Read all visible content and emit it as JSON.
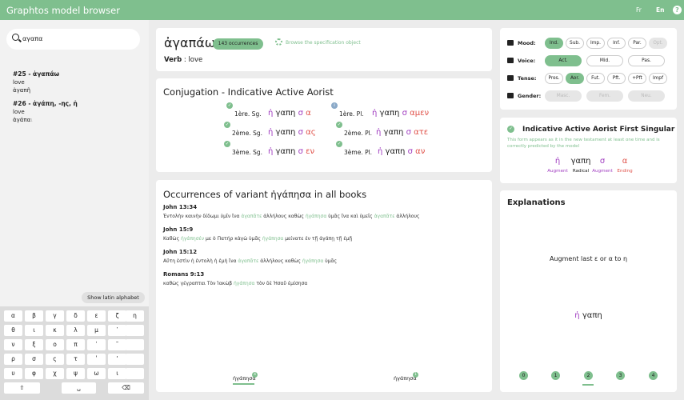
{
  "header": {
    "title": "Graphtos model browser",
    "lang_fr": "Fr",
    "lang_en": "En",
    "help": "?"
  },
  "search": {
    "value": "αγαπα"
  },
  "results": [
    {
      "title": "#25 - ἀγαπάω",
      "gloss": "love",
      "form": "ἀγαπῆ"
    },
    {
      "title": "#26 - ἀγάπη, -ης, ἡ",
      "gloss": "love",
      "form": "ἀγάπα",
      "form_trailing": "ι"
    }
  ],
  "keyboard": {
    "toggle_label": "Show latin alphabet",
    "rows": [
      [
        "α",
        "β",
        "γ",
        "δ",
        "ε",
        "ζ",
        "η"
      ],
      [
        "θ",
        "ι",
        "κ",
        "λ",
        "μ",
        "῾",
        ""
      ],
      [
        "ν",
        "ξ",
        "ο",
        "π",
        "᾿",
        "῀",
        ""
      ],
      [
        "ρ",
        "σ",
        "ς",
        "τ",
        "ʹ",
        "ʼ",
        ""
      ],
      [
        "υ",
        "φ",
        "χ",
        "ψ",
        "ω",
        "ι",
        ""
      ]
    ],
    "shift": "⇧",
    "space": "␣",
    "backspace": "⌫"
  },
  "lemma": {
    "word": "ἀγαπάω",
    "occurrences": "143 occurrences",
    "spec_link": "Browse the specification object",
    "pos": "Verb",
    "gloss": "love"
  },
  "conjugation": {
    "title": "Conjugation - Indicative Active Aorist",
    "items": [
      {
        "label": "1ère. Sg.",
        "aug": "ἠ",
        "rad": "γαπη",
        "ind": "σ",
        "end": "α",
        "status": "check"
      },
      {
        "label": "2ème. Sg.",
        "aug": "ἠ",
        "rad": "γαπη",
        "ind": "σ",
        "end": "ας",
        "status": "check"
      },
      {
        "label": "3ème. Sg.",
        "aug": "ἠ",
        "rad": "γαπη",
        "ind": "σ",
        "end": "εν",
        "status": "check"
      },
      {
        "label": "1ère. Pl.",
        "aug": "ἠ",
        "rad": "γαπη",
        "ind": "σ",
        "end": "αμεν",
        "status": "info"
      },
      {
        "label": "2ème. Pl.",
        "aug": "ἠ",
        "rad": "γαπη",
        "ind": "σ",
        "end": "ατε",
        "status": "check"
      },
      {
        "label": "3ème. Pl.",
        "aug": "ἠ",
        "rad": "γαπη",
        "ind": "σ",
        "end": "αν",
        "status": "check"
      }
    ]
  },
  "occurrences": {
    "title": "Occurrences of variant ἠγάπησα in all books",
    "verses": [
      {
        "ref": "John 13:34",
        "parts": [
          "Ἐντολὴν καινὴν δίδωμι ὑμῖν ἵνα ",
          {
            "hl": "ἀγαπᾶτε"
          },
          " ἀλλήλους καθὼς ",
          {
            "hl": "ἠγάπησα"
          },
          " ὑμᾶς ἵνα καὶ ὑμεῖς ",
          {
            "hl": "ἀγαπᾶτε"
          },
          " ἀλλήλους"
        ]
      },
      {
        "ref": "John 15:9",
        "parts": [
          "Καθὼς ",
          {
            "hl": "ἠγάπησέν"
          },
          " με ὁ Πατήρ κἀγὼ ὑμᾶς ",
          {
            "hl": "ἠγάπησα"
          },
          " μείνατε ἐν τῇ ἀγάπῃ τῇ ἐμῇ"
        ]
      },
      {
        "ref": "John 15:12",
        "parts": [
          "Αὕτη ἐστὶν ἡ ἐντολὴ ἡ ἐμὴ ἵνα ",
          {
            "hl": "ἀγαπᾶτε"
          },
          " ἀλλήλους καθὼς ",
          {
            "hl": "ἠγάπησα"
          },
          " ὑμᾶς"
        ]
      },
      {
        "ref": "Romans 9:13",
        "parts": [
          "καθὼς γέγραπται Τὸν Ἰακὼβ ",
          {
            "hl": "ἠγάπησα"
          },
          " τὸν δὲ Ἠσαῦ ἐμίσησα"
        ]
      }
    ],
    "tabs": [
      {
        "label": "ἠγάπησα",
        "count": "4",
        "active": true
      },
      {
        "label": "ἠγάπησα",
        "count": "1",
        "active": false
      }
    ]
  },
  "filters": {
    "mood": {
      "label": "Mood:",
      "options": [
        {
          "t": "Ind.",
          "s": "sel"
        },
        {
          "t": "Sub.",
          "s": ""
        },
        {
          "t": "Imp.",
          "s": ""
        },
        {
          "t": "Inf.",
          "s": ""
        },
        {
          "t": "Par.",
          "s": ""
        },
        {
          "t": "Opt.",
          "s": "dis"
        }
      ]
    },
    "voice": {
      "label": "Voice:",
      "options": [
        {
          "t": "Act.",
          "s": "sel"
        },
        {
          "t": "Mid.",
          "s": ""
        },
        {
          "t": "Pas.",
          "s": ""
        }
      ]
    },
    "tense": {
      "label": "Tense:",
      "options": [
        {
          "t": "Pres.",
          "s": ""
        },
        {
          "t": "Aor.",
          "s": "sel"
        },
        {
          "t": "Fut.",
          "s": ""
        },
        {
          "t": "Pft.",
          "s": ""
        },
        {
          "t": "+Pft",
          "s": ""
        },
        {
          "t": "Impf",
          "s": ""
        }
      ]
    },
    "gender": {
      "label": "Gender:",
      "options": [
        {
          "t": "Masc.",
          "s": "dis"
        },
        {
          "t": "Fem.",
          "s": "dis"
        },
        {
          "t": "Neu.",
          "s": "dis"
        }
      ]
    }
  },
  "form": {
    "title": "Indicative Active Aorist First Singular",
    "description": "This form appears as it in the new testament at least one time and is correctly predicted by the model",
    "parts": [
      {
        "text": "ἠ",
        "label": "Augment",
        "color": "#a03dc0"
      },
      {
        "text": "γαπη",
        "label": "Radical",
        "color": "#222222"
      },
      {
        "text": "σ",
        "label": "Augment",
        "color": "#a03dc0"
      },
      {
        "text": "α",
        "label": "Ending",
        "color": "#e0524a"
      }
    ]
  },
  "explanations": {
    "title": "Explanations",
    "text": "Augment last ε or α to η",
    "word_aug": "ἠ",
    "word_rad": "γαπη",
    "steps": [
      "0",
      "1",
      "2",
      "3",
      "4"
    ],
    "active_step": "2"
  },
  "colors": {
    "accent": "#7fbf8e",
    "augment": "#a03dc0",
    "ending": "#e0524a"
  }
}
